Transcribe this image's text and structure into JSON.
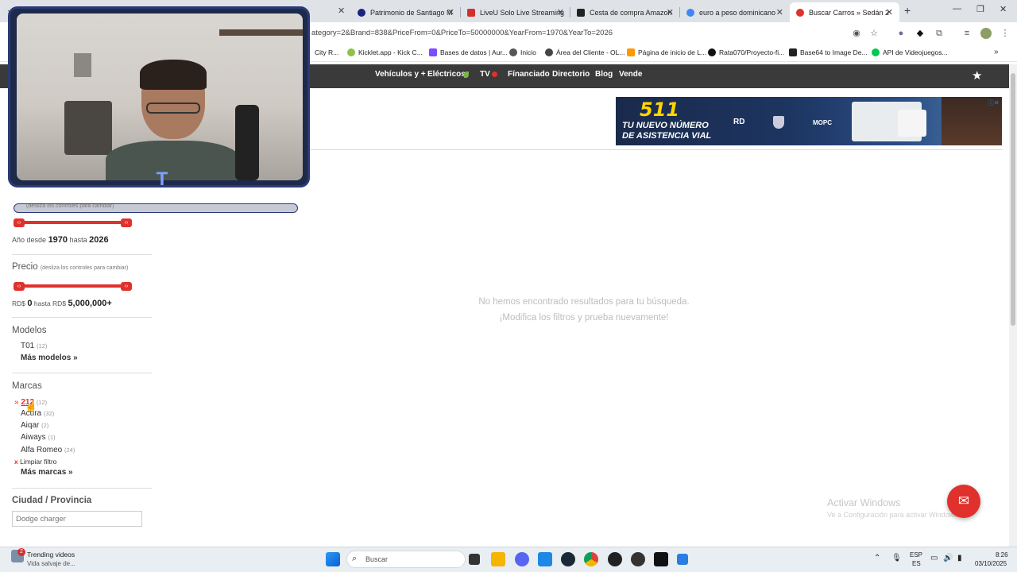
{
  "browser": {
    "tabs": [
      {
        "label": "Patrimonio de Santiago M",
        "color": "#1a237e"
      },
      {
        "label": "LiveU Solo Live Streaming",
        "color": "#d32f2f"
      },
      {
        "label": "Cesta de compra Amazon",
        "color": "#222"
      },
      {
        "label": "euro a peso dominicano",
        "color": "#4285f4"
      },
      {
        "label": "Buscar Carros » Sedán 2",
        "color": "#e0312d"
      }
    ],
    "url": "ategory=2&Brand=838&PriceFrom=0&PriceTo=50000000&YearFrom=1970&YearTo=2026",
    "bookmarks": [
      {
        "label": "City R...",
        "color": "#e0312d"
      },
      {
        "label": "Kicklet.app - Kick C...",
        "color": "#8bc34a"
      },
      {
        "label": "Bases de datos | Aur...",
        "color": "#7c4dff"
      },
      {
        "label": "Inicio",
        "color": "#333"
      },
      {
        "label": "Área del Cliente - OL...",
        "color": "#333"
      },
      {
        "label": "Página de inicio de L...",
        "color": "#ff9800"
      },
      {
        "label": "Rata070/Proyecto-fi...",
        "color": "#111"
      },
      {
        "label": "Base64 to Image De...",
        "color": "#222"
      },
      {
        "label": "API de Videojuegos...",
        "color": "#00c853"
      }
    ]
  },
  "nav": {
    "items": [
      "Vehículos y +",
      "Eléctricos",
      "TV",
      "Fínanciado",
      "Directorio",
      "Blog",
      "Vende"
    ]
  },
  "ad": {
    "number": "511",
    "line1": "TU NUEVO NÚMERO",
    "line2": "DE ASISTENCIA VIAL",
    "logos": [
      "RD",
      "MOPC"
    ]
  },
  "sidebar": {
    "year": {
      "hint": "(desliza los controles para cambiar)",
      "prefix": "Año desde",
      "from": "1970",
      "mid": "hasta",
      "to": "2026"
    },
    "price": {
      "title": "Precio",
      "hint": "(desliza los controles para cambiar)",
      "prefix": "RD$",
      "from": "0",
      "mid": "hasta RD$",
      "to": "5,000,000+"
    },
    "models": {
      "title": "Modelos",
      "items": [
        {
          "name": "T01",
          "count": "(12)"
        }
      ],
      "more": "Más modelos »"
    },
    "brands": {
      "title": "Marcas",
      "selected": {
        "marker": "»",
        "name": "212",
        "count": "(12)"
      },
      "items": [
        {
          "name": "Acura",
          "count": "(32)"
        },
        {
          "name": "Aiqar",
          "count": "(2)"
        },
        {
          "name": "Aiways",
          "count": "(1)"
        },
        {
          "name": "Alfa Romeo",
          "count": "(24)"
        }
      ],
      "clear_marker": "x",
      "clear": "Limpiar filtro",
      "more": "Más marcas »"
    },
    "city": {
      "title": "Ciudad / Provincia",
      "placeholder": "Dodge charger"
    }
  },
  "results": {
    "line1": "No hemos encontrado resultados para tu búsqueda.",
    "line2": "¡Modifica los filtros y prueba nuevamente!"
  },
  "windows": {
    "activate_title": "Activar Windows",
    "activate_sub": "Ve a Configuración para activar Windows."
  },
  "taskbar": {
    "widget_title": "Trending videos",
    "widget_sub": "Vida salvaje de...",
    "badge": "2",
    "search_placeholder": "Buscar",
    "lang": "ESP",
    "lang2": "ES",
    "time": "8:26",
    "date": "03/10/2025"
  }
}
